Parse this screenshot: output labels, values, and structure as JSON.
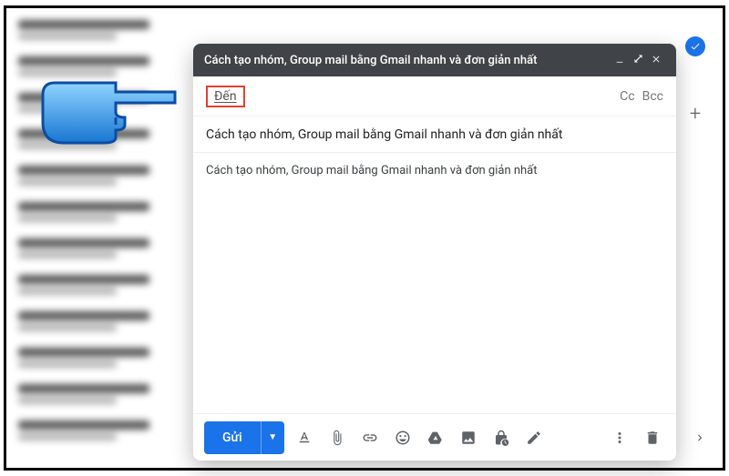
{
  "compose": {
    "title_bar": "Cách tạo nhóm, Group mail bằng Gmail nhanh và đơn giản nhất",
    "to_label": "Đến",
    "cc_label": "Cc",
    "bcc_label": "Bcc",
    "subject_value": "Cách tạo nhóm, Group mail bằng Gmail nhanh và đơn giản nhất",
    "body_text": "Cách tạo nhóm, Group mail bằng Gmail nhanh và đơn giản nhất",
    "send_label": "Gửi"
  },
  "toolbar_icons": {
    "format": "format-text-icon",
    "attach": "paperclip-icon",
    "link": "link-icon",
    "emoji": "smiley-icon",
    "drive": "drive-icon",
    "photo": "image-icon",
    "confidential": "lock-clock-icon",
    "pen": "pen-icon",
    "more": "more-vert-icon",
    "trash": "trash-icon"
  },
  "window_controls": {
    "minimize": "minimize-icon",
    "fullscreen": "expand-icon",
    "close": "close-icon"
  },
  "sidepanel": {
    "tasks": "checkmark-chip-icon",
    "add": "plus-icon",
    "expand": "chevron-right-icon"
  }
}
